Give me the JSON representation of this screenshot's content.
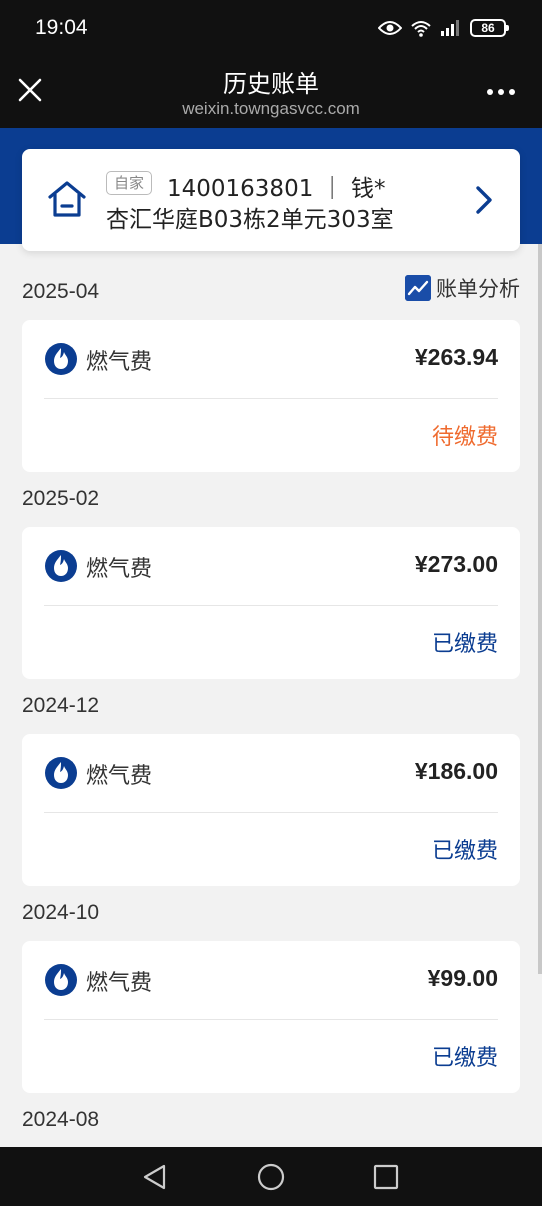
{
  "status_bar": {
    "time": "19:04",
    "battery": "86",
    "icons": [
      "eye-icon",
      "wifi-icon",
      "signal-icon",
      "battery-icon"
    ]
  },
  "nav": {
    "title": "历史账单",
    "subtitle": "weixin.towngasvcc.com",
    "icons": [
      "close-icon",
      "more-icon"
    ]
  },
  "account": {
    "tag": "自家",
    "line1": "1400163801 ｜ 钱*",
    "address": "杏汇华庭B03栋2单元303室"
  },
  "analysis_label": "账单分析",
  "bills": [
    {
      "month": "2025-04",
      "name": "燃气费",
      "amount": "¥263.94",
      "status": "待缴费",
      "state": "pending"
    },
    {
      "month": "2025-02",
      "name": "燃气费",
      "amount": "¥273.00",
      "status": "已缴费",
      "state": "paid"
    },
    {
      "month": "2024-12",
      "name": "燃气费",
      "amount": "¥186.00",
      "status": "已缴费",
      "state": "paid"
    },
    {
      "month": "2024-10",
      "name": "燃气费",
      "amount": "¥99.00",
      "status": "已缴费",
      "state": "paid"
    }
  ],
  "next_month": "2024-08",
  "colors": {
    "brand_blue": "#0b3d91",
    "pending_orange": "#ef6b2f"
  }
}
